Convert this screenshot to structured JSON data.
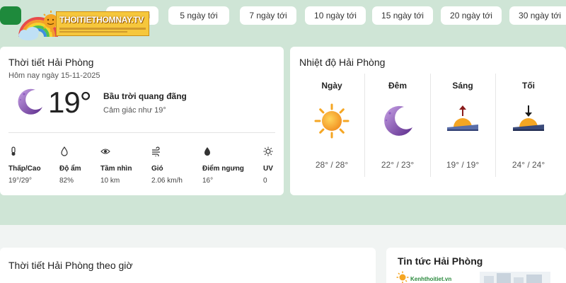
{
  "tabs": [
    {
      "label": "",
      "active": true
    },
    {
      "label": "tới"
    },
    {
      "label": "5 ngày tới"
    },
    {
      "label": "7 ngày tới"
    },
    {
      "label": "10 ngày tới"
    },
    {
      "label": "15 ngày tới"
    },
    {
      "label": "20 ngày tới"
    },
    {
      "label": "30 ngày tới"
    }
  ],
  "logo": {
    "text": "THOITIETHOMNAY.TV"
  },
  "current": {
    "title": "Thời tiết Hải Phòng",
    "date": "Hôm nay ngày 15-11-2025",
    "temp": "19°",
    "condition": "Bầu trời quang đãng",
    "feels_like": "Cảm giác như 19°",
    "icon": "crescent-moon-icon"
  },
  "stats": [
    {
      "icon": "thermometer-icon",
      "label": "Thấp/Cao",
      "value": "19°/29°"
    },
    {
      "icon": "droplet-icon",
      "label": "Độ ẩm",
      "value": "82%"
    },
    {
      "icon": "eye-icon",
      "label": "Tầm nhìn",
      "value": "10 km"
    },
    {
      "icon": "wind-icon",
      "label": "Gió",
      "value": "2.06 km/h"
    },
    {
      "icon": "dew-drop-icon",
      "label": "Điểm ngưng",
      "value": "16°"
    },
    {
      "icon": "sun-uv-icon",
      "label": "UV",
      "value": "0"
    }
  ],
  "daily": {
    "title": "Nhiệt độ Hải Phòng",
    "periods": [
      {
        "name": "Ngày",
        "temp": "28° / 28°",
        "icon": "sun-icon"
      },
      {
        "name": "Đêm",
        "temp": "22° / 23°",
        "icon": "crescent-moon-icon"
      },
      {
        "name": "Sáng",
        "temp": "19° / 19°",
        "icon": "sunrise-icon"
      },
      {
        "name": "Tối",
        "temp": "24° / 24°",
        "icon": "sunset-icon"
      }
    ]
  },
  "hourly": {
    "title": "Thời tiết Hải Phòng theo giờ"
  },
  "news": {
    "title": "Tin tức Hải Phòng",
    "logo_text": "Kenhthoitiet.vn"
  },
  "colors": {
    "accent": "#1e8a3c",
    "page_bg": "#cfe5d6",
    "moon": "#7b3fa6",
    "sun": "#f5a623"
  }
}
